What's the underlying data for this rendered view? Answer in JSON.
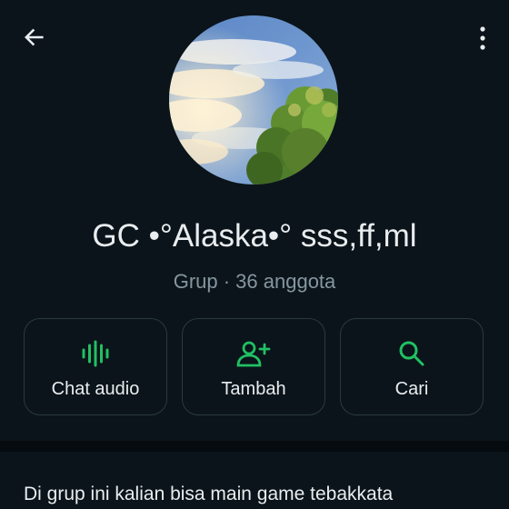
{
  "header": {
    "back_icon": "arrow-left-icon",
    "more_icon": "more-vertical-icon"
  },
  "profile": {
    "avatar": "group-photo",
    "name": "GC •°Alaska•° sss,ff,ml",
    "meta": "Grup · 36 anggota"
  },
  "actions": [
    {
      "icon": "audio-wave-icon",
      "label": "Chat audio"
    },
    {
      "icon": "add-person-icon",
      "label": "Tambah"
    },
    {
      "icon": "search-icon",
      "label": "Cari"
    }
  ],
  "description": {
    "text": "Di grup ini kalian bisa main game tebakkata"
  },
  "colors": {
    "background": "#0b141a",
    "accent": "#21c063",
    "text_primary": "#e9edef",
    "text_secondary": "#8696a0",
    "card_border": "#2a3942"
  }
}
